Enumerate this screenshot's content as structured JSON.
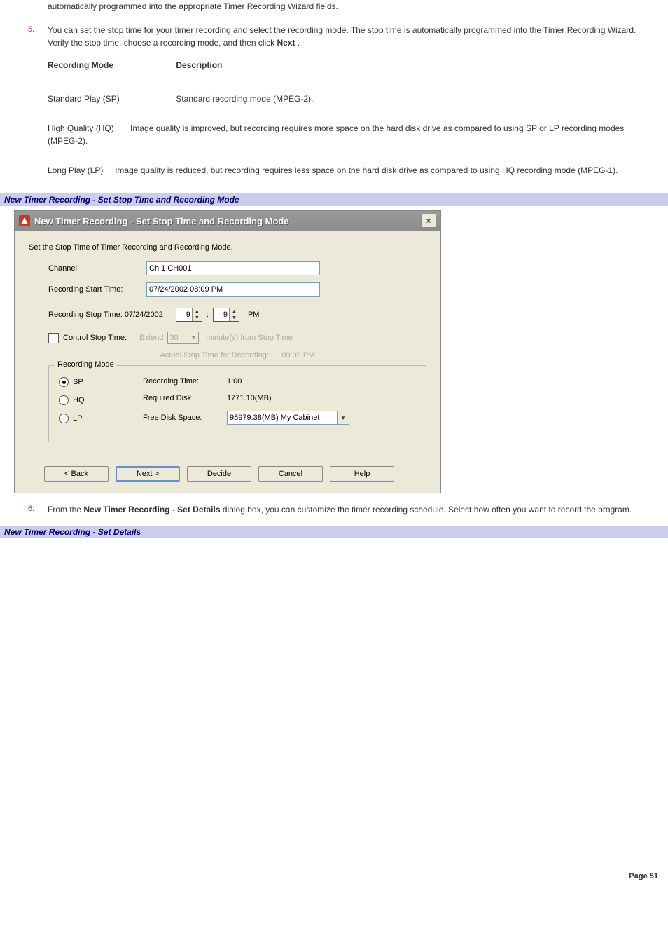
{
  "intro_tail": "automatically programmed into the appropriate Timer Recording Wizard fields.",
  "step5_a": "You can set the stop time for your timer recording and select the recording mode. The stop time is automatically programmed into the Timer Recording Wizard. Verify the stop time, choose a recording mode, and then click ",
  "step5_bold": "Next",
  "step5_b": " .",
  "tbl": {
    "h1": "Recording Mode",
    "h2": "Description",
    "r1c1": "Standard Play (SP)",
    "r1c2": "Standard recording mode (MPEG-2).",
    "r2c1": "High Quality (HQ)",
    "r2c2": "Image quality is improved, but recording requires more space on the hard disk drive as compared to using SP or LP recording modes (MPEG-2).",
    "r3c1": "Long Play (LP)",
    "r3c2": "Image quality is reduced, but recording requires less space on the hard disk drive as compared to using HQ recording mode (MPEG-1)."
  },
  "bar1": "New Timer Recording - Set Stop Time and Recording Mode",
  "dialog": {
    "title": "New Timer Recording - Set Stop Time and Recording Mode",
    "caption": "Set the Stop Time of Timer Recording and Recording Mode.",
    "channel_label": "Channel:",
    "channel_value": "Ch 1 CH001",
    "start_label": "Recording Start Time:",
    "start_value": "07/24/2002 08:09 PM",
    "stop_label": "Recording Stop Time: 07/24/2002",
    "stop_hour": "9",
    "stop_min": "9",
    "stop_ampm": "PM",
    "colon": ":",
    "ctrl_label": "Control Stop Time:",
    "extend": "Extend",
    "extend_val": "30",
    "extend_tail": "minute(s) from Stop Time",
    "actual_label": "Actual Stop Time for Recording:",
    "actual_val": "09:09 PM",
    "group": "Recording Mode",
    "radios": {
      "sp": "SP",
      "hq": "HQ",
      "lp": "LP"
    },
    "info": {
      "rt_label": "Recording Time:",
      "rt_val": "1:00",
      "rd_label": "Required Disk",
      "rd_val": "1771.10(MB)",
      "fd_label": "Free Disk Space:",
      "fd_val": "95979.38(MB) My Cabinet"
    },
    "buttons": {
      "back": "< Back",
      "next": "Next >",
      "decide": "Decide",
      "cancel": "Cancel",
      "help": "Help"
    }
  },
  "step6_a": "From the ",
  "step6_bold": "New Timer Recording - Set Details",
  "step6_b": " dialog box, you can customize the timer recording schedule. Select how often you want to record the program.",
  "bar2": "New Timer Recording - Set Details",
  "page_num": "Page 51"
}
